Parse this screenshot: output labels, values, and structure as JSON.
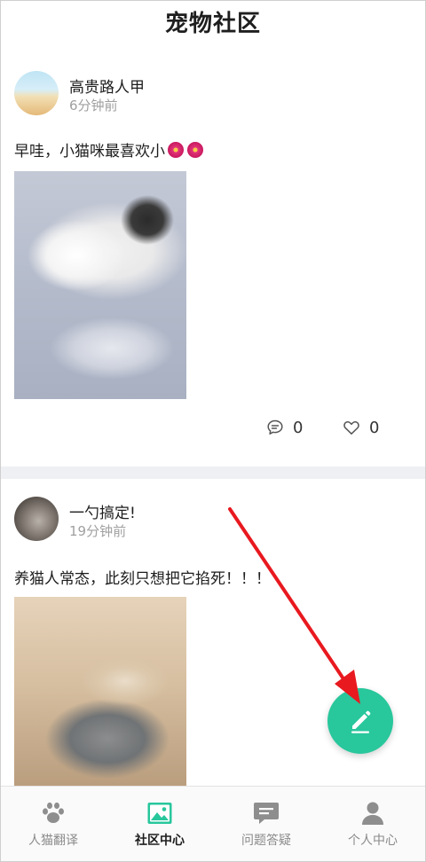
{
  "header": {
    "title": "宠物社区"
  },
  "posts": [
    {
      "username": "高贵路人甲",
      "time": "6分钟前",
      "content": "早哇，小猫咪最喜欢小",
      "emoji": [
        "hibiscus-emoji",
        "hibiscus-emoji"
      ],
      "comments": "0",
      "likes": "0"
    },
    {
      "username": "一勺搞定!",
      "time": "19分钟前",
      "content": "养猫人常态，此刻只想把它掐死！！！"
    }
  ],
  "fab": {
    "icon": "pen-icon",
    "color": "#28c79c"
  },
  "tabbar": {
    "tabs": [
      {
        "label": "人猫翻译",
        "icon": "paw-icon"
      },
      {
        "label": "社区中心",
        "icon": "image-icon",
        "active": true
      },
      {
        "label": "问题答疑",
        "icon": "chat-icon"
      },
      {
        "label": "个人中心",
        "icon": "person-icon"
      }
    ]
  },
  "colors": {
    "accent": "#28c79c",
    "annotation_arrow": "#e8191f"
  }
}
